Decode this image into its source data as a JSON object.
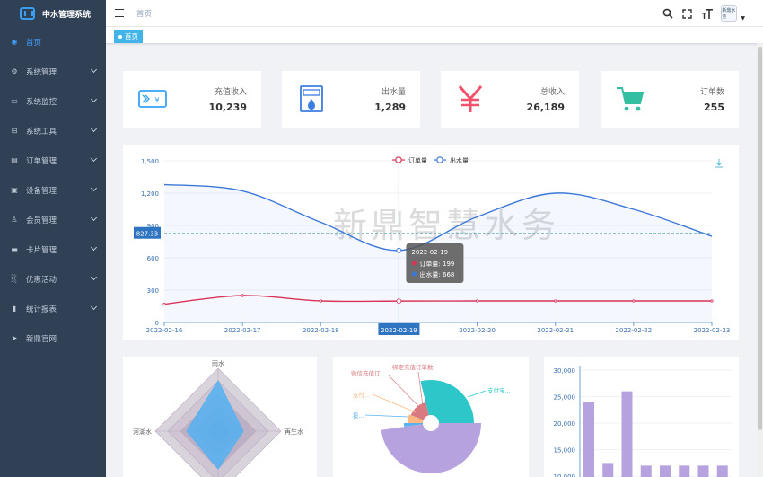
{
  "app": {
    "title": "中水管理系统"
  },
  "sidebar": {
    "items": [
      {
        "label": "首页",
        "icon": "dashboard-icon"
      },
      {
        "label": "系统管理",
        "icon": "gear-icon"
      },
      {
        "label": "系统监控",
        "icon": "monitor-icon"
      },
      {
        "label": "系统工具",
        "icon": "toolbox-icon"
      },
      {
        "label": "订单管理",
        "icon": "order-icon"
      },
      {
        "label": "设备管理",
        "icon": "device-icon"
      },
      {
        "label": "会员管理",
        "icon": "members-icon"
      },
      {
        "label": "卡片管理",
        "icon": "card-icon"
      },
      {
        "label": "优惠活动",
        "icon": "promo-icon"
      },
      {
        "label": "统计报表",
        "icon": "report-icon"
      },
      {
        "label": "新鼎官网",
        "icon": "send-icon"
      }
    ]
  },
  "header": {
    "breadcrumb": "首页",
    "tag": "首页",
    "avatar_text": "新鼎水务"
  },
  "stats": [
    {
      "label": "充值收入",
      "value": "10,239",
      "icon": "recharge-icon",
      "color": "#36a3f7"
    },
    {
      "label": "出水量",
      "value": "1,289",
      "icon": "water-dispenser-icon",
      "color": "#3b7de0"
    },
    {
      "label": "总收入",
      "value": "26,189",
      "icon": "yuan-icon",
      "color": "#f4516c"
    },
    {
      "label": "订单数",
      "value": "255",
      "icon": "cart-icon",
      "color": "#34bfa3"
    }
  ],
  "watermark": "新鼎智慧水务",
  "chart_data": [
    {
      "type": "line",
      "x": [
        "2022-02-16",
        "2022-02-17",
        "2022-02-18",
        "2022-02-19",
        "2022-02-20",
        "2022-02-21",
        "2022-02-22",
        "2022-02-23"
      ],
      "series": [
        {
          "name": "订单量",
          "color": "#d9345a",
          "values": [
            170,
            250,
            200,
            199,
            200,
            200,
            200,
            200
          ]
        },
        {
          "name": "出水量",
          "color": "#3c78d8",
          "values": [
            1280,
            1220,
            930,
            668,
            980,
            1200,
            1050,
            800
          ]
        }
      ],
      "ylim": [
        0,
        1500
      ],
      "yticks": [
        "0",
        "300",
        "600",
        "900",
        "1,200",
        "1,500"
      ],
      "crosshair_value": "827.33",
      "highlight_x": "2022-02-19",
      "tooltip": {
        "title": "2022-02-19",
        "rows": [
          "订单量: 199",
          "出水量: 668"
        ]
      },
      "legend": "top-center"
    },
    {
      "type": "radar",
      "indicators": [
        "雨水",
        "再生水",
        "河湖水"
      ],
      "values": [
        0.8,
        0.4,
        0.5
      ]
    },
    {
      "type": "pie",
      "labels": [
        "绑定充值订单数",
        "微信充值订...",
        "支付...",
        "投...",
        "支付宝..."
      ],
      "colors": [
        "#b6a2de",
        "#5ab1ef",
        "#ffb980",
        "#d87a80",
        "#2ec7c9"
      ]
    },
    {
      "type": "bar",
      "values": [
        24000,
        12500,
        26000,
        12000,
        12000,
        12000,
        12000,
        12000
      ],
      "yticks": [
        "10,000",
        "15,000",
        "20,000",
        "25,000",
        "30,000"
      ],
      "ylim": [
        8000,
        30000
      ],
      "color": "#b6a2de"
    }
  ]
}
